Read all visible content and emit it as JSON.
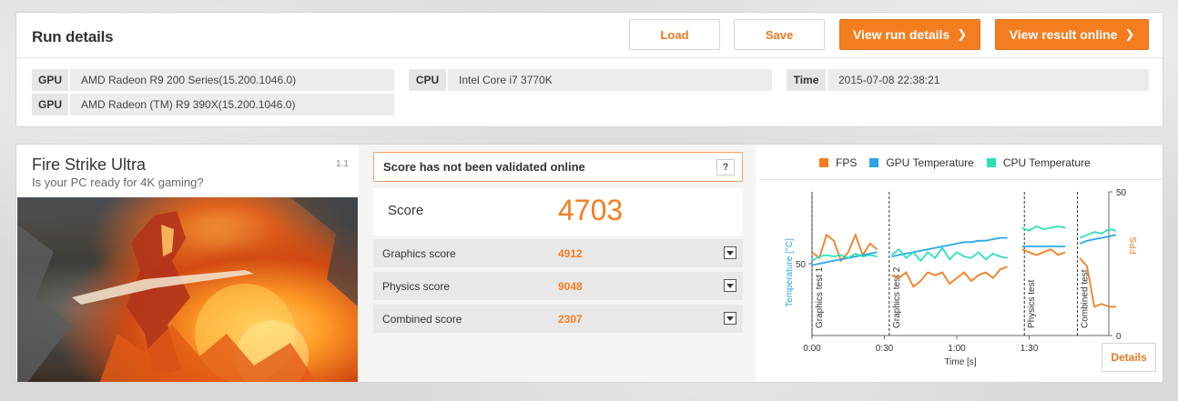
{
  "run": {
    "title": "Run details",
    "load_label": "Load",
    "save_label": "Save",
    "view_run_label": "View run details",
    "view_online_label": "View result online",
    "gpu1_key": "GPU",
    "gpu1_val": "AMD Radeon R9 200 Series(15.200.1046.0)",
    "gpu2_key": "GPU",
    "gpu2_val": "AMD Radeon (TM) R9 390X(15.200.1046.0)",
    "cpu_key": "CPU",
    "cpu_val": "Intel Core i7 3770K",
    "time_key": "Time",
    "time_val": "2015-07-08 22:38:21"
  },
  "bench": {
    "title": "Fire Strike Ultra",
    "version": "1.1",
    "subtitle": "Is your PC ready for 4K gaming?"
  },
  "scores": {
    "validation_msg": "Score has not been validated online",
    "help": "?",
    "score_label": "Score",
    "score_value": "4703",
    "rows": [
      {
        "label": "Graphics score",
        "value": "4912"
      },
      {
        "label": "Physics score",
        "value": "9048"
      },
      {
        "label": "Combined score",
        "value": "2307"
      }
    ]
  },
  "chart": {
    "details_label": "Details",
    "colors": {
      "fps": "#f47d20",
      "gpu": "#2aa6e8",
      "cpu": "#2de0b8"
    }
  },
  "chart_data": {
    "type": "line",
    "series": [
      {
        "name": "FPS",
        "axis": "right",
        "x": [
          0,
          3,
          6,
          9,
          12,
          15,
          18,
          21,
          24,
          27,
          30,
          33,
          36,
          39,
          42,
          45,
          48,
          51,
          54,
          57,
          60,
          63,
          66,
          69,
          72,
          75,
          78,
          81,
          84,
          87,
          90,
          93,
          96,
          99,
          102,
          105,
          108,
          111,
          114,
          117,
          120,
          123,
          126
        ],
        "y": [
          29,
          27,
          35,
          33,
          26,
          29,
          35,
          28,
          32,
          30,
          null,
          21,
          20,
          22,
          17,
          19,
          22,
          21,
          22,
          18,
          20,
          22,
          19,
          21,
          22,
          20,
          23,
          24,
          null,
          30,
          29,
          28,
          29,
          30,
          28,
          29,
          null,
          27,
          24,
          10,
          11,
          10,
          10
        ]
      },
      {
        "name": "GPU Temperature",
        "axis": "left",
        "x": [
          0,
          3,
          6,
          9,
          12,
          15,
          18,
          21,
          24,
          27,
          30,
          33,
          36,
          39,
          42,
          45,
          48,
          51,
          54,
          57,
          60,
          63,
          66,
          69,
          72,
          75,
          78,
          81,
          84,
          87,
          90,
          93,
          96,
          99,
          102,
          105,
          108,
          111,
          114,
          117,
          120,
          123,
          126
        ],
        "y": [
          49,
          50,
          51,
          52,
          53,
          54,
          55,
          56,
          57,
          58,
          null,
          55,
          56,
          57,
          58,
          59,
          60,
          61,
          62,
          63,
          64,
          65,
          65,
          66,
          66,
          67,
          68,
          68,
          null,
          62,
          62,
          62,
          62,
          62,
          62,
          62,
          null,
          64,
          66,
          67,
          68,
          69,
          70
        ]
      },
      {
        "name": "CPU Temperature",
        "axis": "left",
        "x": [
          0,
          3,
          6,
          9,
          12,
          15,
          18,
          21,
          24,
          27,
          30,
          33,
          36,
          39,
          42,
          45,
          48,
          51,
          54,
          57,
          60,
          63,
          66,
          69,
          72,
          75,
          78,
          81,
          84,
          87,
          90,
          93,
          96,
          99,
          102,
          105,
          108,
          111,
          114,
          117,
          120,
          123,
          126
        ],
        "y": [
          52,
          55,
          56,
          55,
          56,
          54,
          57,
          55,
          56,
          55,
          null,
          56,
          60,
          54,
          58,
          52,
          58,
          54,
          61,
          53,
          58,
          55,
          54,
          58,
          53,
          57,
          55,
          54,
          null,
          75,
          73,
          76,
          74,
          75,
          76,
          75,
          null,
          68,
          70,
          72,
          71,
          74,
          73
        ]
      }
    ],
    "sections": [
      {
        "label": "Graphics test 1",
        "start": 0
      },
      {
        "label": "Graphics test 2",
        "start": 32
      },
      {
        "label": "Physics test",
        "start": 88
      },
      {
        "label": "Combined test",
        "start": 110
      }
    ],
    "xlabel": "Time [s]",
    "ylabel_left": "Temperature [°C]",
    "ylabel_right": "FPS",
    "x_ticks": [
      "0:00",
      "0:30",
      "1:00",
      "1:30"
    ],
    "x_tick_values": [
      0,
      30,
      60,
      90
    ],
    "xlim": [
      0,
      123
    ],
    "ylim_left": [
      0,
      100
    ],
    "ylim_right": [
      0,
      50
    ],
    "left_ticks": [
      50
    ],
    "right_ticks": [
      0,
      50
    ]
  }
}
